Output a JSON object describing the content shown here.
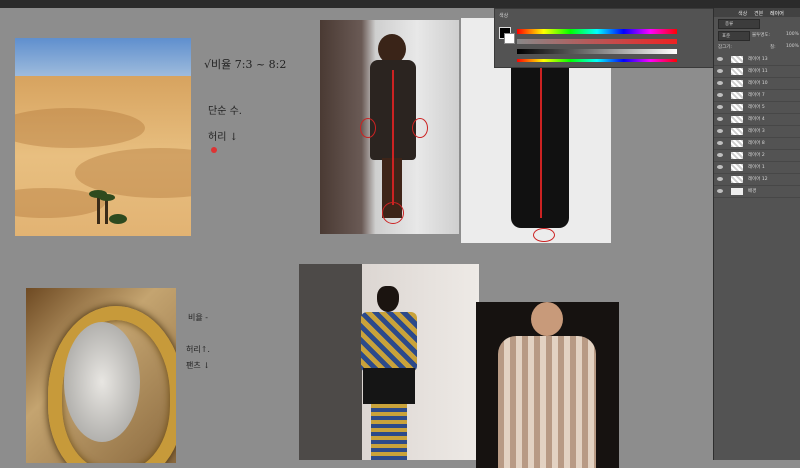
{
  "notes": {
    "ratio": "√비율 7:3 ~ 8:2",
    "line": "단순 수.",
    "waist": "허리 ↓",
    "block2_1": "비율 -",
    "block2_2": "허리↑.",
    "block2_3": "팬츠 ↓"
  },
  "images": [
    {
      "name": "desert-photo",
      "desc": "desert dunes with palm trees"
    },
    {
      "name": "runway-leather-dress"
    },
    {
      "name": "black-gown-product"
    },
    {
      "name": "baroque-mirror"
    },
    {
      "name": "runway-printed-look"
    },
    {
      "name": "embellished-jacket-look"
    }
  ],
  "panels": {
    "color_tab": "색상",
    "tabs": [
      "색상",
      "견본",
      "레이어"
    ],
    "blend_mode": "표준",
    "opacity_label": "불투명도:",
    "opacity_value": "100%",
    "fill_label": "칠:",
    "fill_value": "100%",
    "lock_label": "잠그기:",
    "search_label": "종류"
  },
  "layers": [
    {
      "name": "레이어 13"
    },
    {
      "name": "레이어 11"
    },
    {
      "name": "레이어 10"
    },
    {
      "name": "레이어 7"
    },
    {
      "name": "레이어 5"
    },
    {
      "name": "레이어 4"
    },
    {
      "name": "레이어 3"
    },
    {
      "name": "레이어 8"
    },
    {
      "name": "레이어 2"
    },
    {
      "name": "레이어 1"
    },
    {
      "name": "레이어 12"
    },
    {
      "name": "배경"
    }
  ],
  "colors": {
    "canvas": "#8d8d8d",
    "panel": "#535353",
    "annotation": "#cc2222"
  }
}
